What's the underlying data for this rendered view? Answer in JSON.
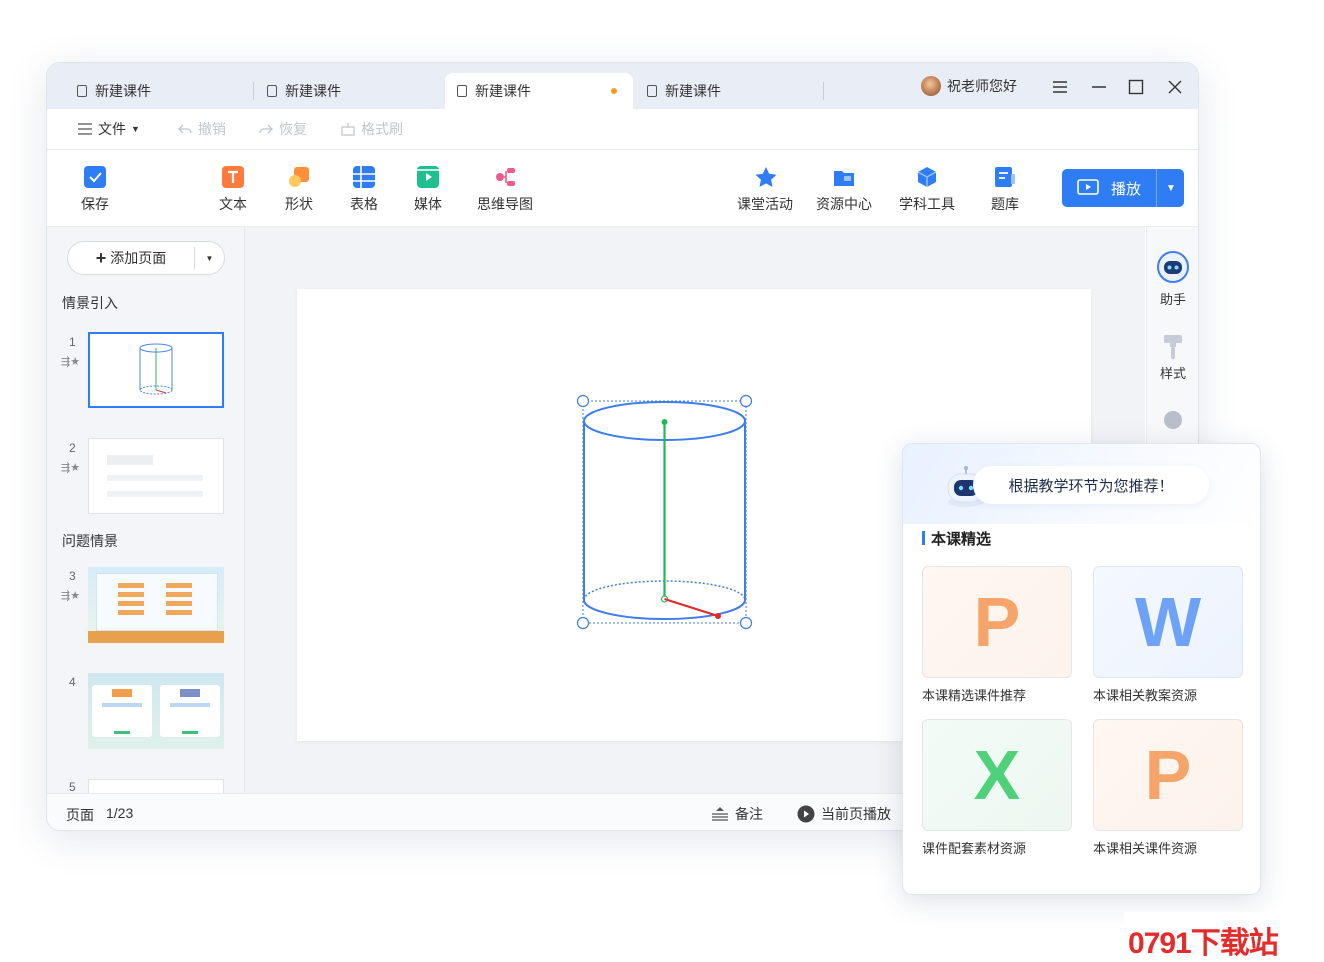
{
  "tabs": [
    {
      "label": "新建课件",
      "active": false
    },
    {
      "label": "新建课件",
      "active": false
    },
    {
      "label": "新建课件",
      "active": true
    },
    {
      "label": "新建课件",
      "active": false
    }
  ],
  "user": {
    "greeting": "祝老师您好"
  },
  "menu": {
    "file": "文件",
    "undo": "撤销",
    "redo": "恢复",
    "format_brush": "格式刷"
  },
  "toolbar": {
    "save": "保存",
    "text": "文本",
    "shape": "形状",
    "table": "表格",
    "media": "媒体",
    "mindmap": "思维导图",
    "class_activity": "课堂活动",
    "resource_center": "资源中心",
    "subject_tools": "学科工具",
    "question_bank": "题库",
    "play": "播放"
  },
  "left_panel": {
    "add_page": "添加页面",
    "section1": "情景引入",
    "section2": "问题情景",
    "thumbnails": [
      "1",
      "2",
      "3",
      "4",
      "5"
    ]
  },
  "right_strip": {
    "assistant": "助手",
    "style": "样式"
  },
  "status": {
    "page_label": "页面",
    "page_value": "1/23",
    "notes": "备注",
    "play_current": "当前页播放"
  },
  "panel": {
    "banner": "根据教学环节为您推荐！",
    "section_title": "本课精选",
    "cards": [
      {
        "letter": "P",
        "label": "本课精选课件推荐",
        "color": "#f6a56a"
      },
      {
        "letter": "W",
        "label": "本课相关教案资源",
        "color": "#6ea2f6"
      },
      {
        "letter": "X",
        "label": "课件配套素材资源",
        "color": "#4fd17a"
      },
      {
        "letter": "P",
        "label": "本课相关课件资源",
        "color": "#f6a56a"
      }
    ]
  },
  "watermark": "0791下载站",
  "colors": {
    "accent": "#2f7df5",
    "active_dot": "#f59c1a"
  }
}
